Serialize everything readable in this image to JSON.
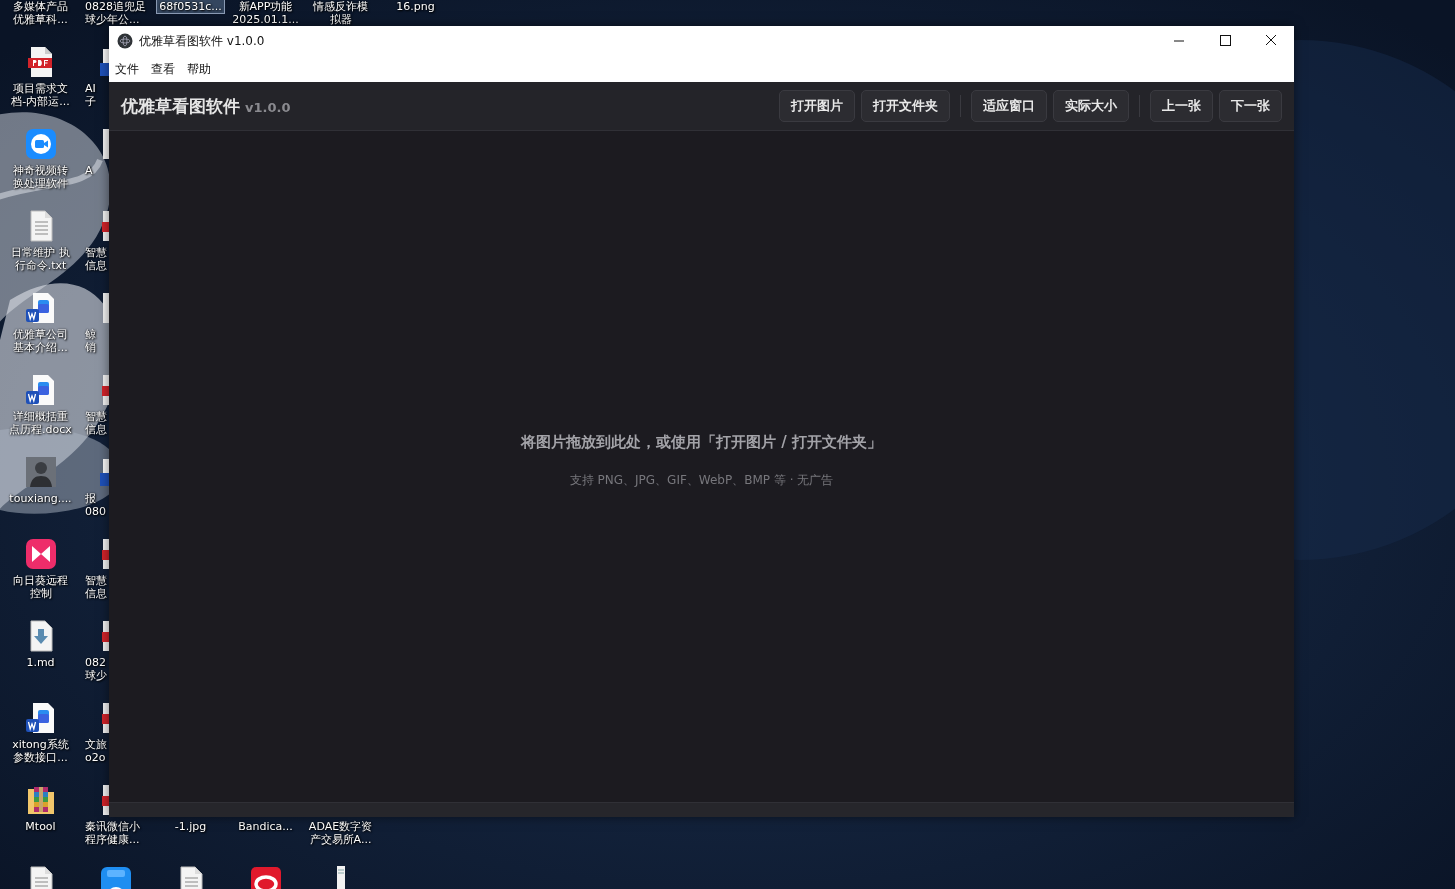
{
  "desktop": {
    "columns": [
      {
        "top": [
          {
            "lines": [
              "多媒体产品",
              "优雅草科..."
            ],
            "selected": false
          },
          {
            "kind": "pdf",
            "lines": [
              "项目需求文",
              "档-内部运..."
            ],
            "selected": false
          },
          {
            "kind": "video",
            "lines": [
              "神奇视频转",
              "换处理软件"
            ],
            "selected": false
          },
          {
            "kind": "txt",
            "lines": [
              "日常维护 执",
              "行命令.txt"
            ],
            "selected": false
          },
          {
            "kind": "word",
            "lines": [
              "优雅草公司",
              "基本介绍..."
            ],
            "selected": false
          },
          {
            "kind": "word",
            "lines": [
              "详细概括重",
              "点历程.docx"
            ],
            "selected": false
          },
          {
            "lines": [
              "touxiang...."
            ],
            "selected": false
          },
          {
            "kind": "remote",
            "lines": [
              "向日葵远程",
              "控制"
            ],
            "selected": false
          },
          {
            "kind": "md",
            "lines": [
              "1.md"
            ],
            "selected": false
          },
          {
            "kind": "word",
            "lines": [
              "xitong系统",
              "参数接口..."
            ],
            "selected": false
          },
          {
            "kind": "archive",
            "lines": [
              "Mtool"
            ],
            "selected": false
          },
          {
            "kind": "txt",
            "selected": false
          }
        ]
      },
      {
        "top": [
          {
            "lines": [
              "0828追兜足",
              "球少年公..."
            ],
            "selected": false
          },
          {
            "kind": "word-edge",
            "lines": [
              "AI",
              "子"
            ],
            "selected": false
          },
          {
            "kind": "doc-edge",
            "lines": [
              "A"
            ],
            "selected": false
          },
          {
            "kind": "pdf-edge",
            "lines": [
              "智慧",
              "信息"
            ],
            "selected": false
          },
          {
            "kind": "doc-edge",
            "lines": [
              "鲸",
              "销"
            ],
            "selected": false
          },
          {
            "kind": "pdf-edge",
            "lines": [
              "智慧",
              "信息"
            ],
            "selected": false
          },
          {
            "kind": "word-edge",
            "lines": [
              "报",
              "080"
            ],
            "selected": false
          },
          {
            "kind": "pdf-edge",
            "lines": [
              "智慧",
              "信息"
            ],
            "selected": false
          },
          {
            "kind": "pdf-edge",
            "lines": [
              "082",
              "球少"
            ],
            "selected": false
          },
          {
            "kind": "pdf-edge",
            "lines": [
              "文旅",
              "o2o"
            ],
            "selected": false
          },
          {
            "kind": "pdf-edge",
            "lines": [
              "秦讯微信小",
              "程序健康..."
            ],
            "selected": false
          },
          {
            "kind": "apk",
            "selected": false
          }
        ]
      },
      {
        "top": [
          {
            "lines": [
              "68f0531c..."
            ],
            "selected": true
          }
        ],
        "bottom": [
          {
            "lines": [
              "-1.jpg"
            ],
            "selected": false
          },
          {
            "kind": "txt",
            "selected": false
          }
        ]
      },
      {
        "top": [
          {
            "lines": [
              "新APP功能",
              "2025.01.1..."
            ],
            "selected": false
          }
        ],
        "bottom": [
          {
            "lines": [
              "Bandica..."
            ],
            "selected": false
          },
          {
            "kind": "ring",
            "selected": false
          }
        ]
      },
      {
        "top": [
          {
            "lines": [
              "情感反诈模",
              "拟器"
            ],
            "selected": false
          }
        ],
        "bottom": [
          {
            "lines": [
              "ADAE数字资",
              "产交易所A..."
            ],
            "selected": false
          },
          {
            "kind": "slim",
            "selected": false
          }
        ]
      },
      {
        "top": [
          {
            "lines": [
              "16.png"
            ],
            "selected": false
          }
        ]
      }
    ]
  },
  "window": {
    "title": "优雅草看图软件 v1.0.0",
    "menu": [
      "文件",
      "查看",
      "帮助"
    ],
    "app_title": "优雅草看图软件",
    "app_version": "v1.0.0",
    "toolbar_groups": [
      [
        "打开图片",
        "打开文件夹"
      ],
      [
        "适应窗口",
        "实际大小"
      ],
      [
        "上一张",
        "下一张"
      ]
    ],
    "hint": "将图片拖放到此处，或使用「打开图片 / 打开文件夹」",
    "sub_hint": "支持 PNG、JPG、GIF、WebP、BMP 等 · 无广告"
  }
}
